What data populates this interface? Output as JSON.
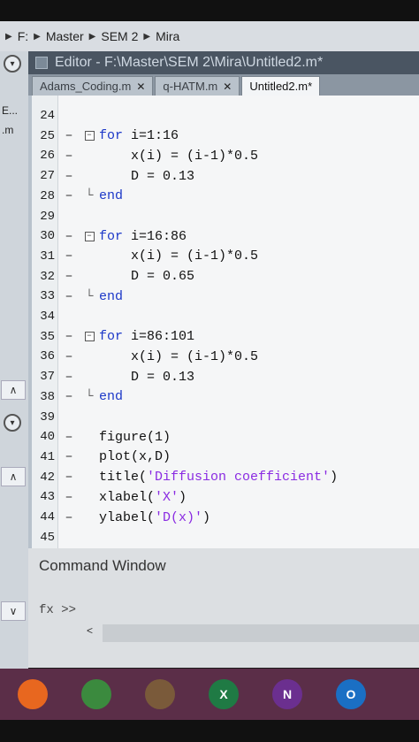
{
  "breadcrumb": {
    "items": [
      "F:",
      "Master",
      "SEM 2",
      "Mira"
    ]
  },
  "left_panel": {
    "file_labels": [
      "E...",
      ".m"
    ]
  },
  "editor": {
    "title": "Editor - F:\\Master\\SEM 2\\Mira\\Untitled2.m*",
    "tabs": [
      {
        "label": "Adams_Coding.m",
        "active": false,
        "closable": true
      },
      {
        "label": "q-HATM.m",
        "active": false,
        "closable": true
      },
      {
        "label": "Untitled2.m*",
        "active": true,
        "closable": false
      }
    ]
  },
  "code_lines": [
    {
      "num": "24",
      "dash": "",
      "fold": "",
      "text": ""
    },
    {
      "num": "25",
      "dash": "–",
      "fold": "⊟",
      "kw": "for",
      "text": " i=1:16"
    },
    {
      "num": "26",
      "dash": "–",
      "fold": "",
      "text": "    x(i) = (i-1)*0.5"
    },
    {
      "num": "27",
      "dash": "–",
      "fold": "",
      "text": "    D = 0.13"
    },
    {
      "num": "28",
      "dash": "–",
      "fold": "└",
      "kw": "end",
      "text": ""
    },
    {
      "num": "29",
      "dash": "",
      "fold": "",
      "text": ""
    },
    {
      "num": "30",
      "dash": "–",
      "fold": "⊟",
      "kw": "for",
      "text": " i=16:86"
    },
    {
      "num": "31",
      "dash": "–",
      "fold": "",
      "text": "    x(i) = (i-1)*0.5"
    },
    {
      "num": "32",
      "dash": "–",
      "fold": "",
      "text": "    D = 0.65"
    },
    {
      "num": "33",
      "dash": "–",
      "fold": "└",
      "kw": "end",
      "text": ""
    },
    {
      "num": "34",
      "dash": "",
      "fold": "",
      "text": ""
    },
    {
      "num": "35",
      "dash": "–",
      "fold": "⊟",
      "kw": "for",
      "text": " i=86:101"
    },
    {
      "num": "36",
      "dash": "–",
      "fold": "",
      "text": "    x(i) = (i-1)*0.5"
    },
    {
      "num": "37",
      "dash": "–",
      "fold": "",
      "text": "    D = 0.13"
    },
    {
      "num": "38",
      "dash": "–",
      "fold": "└",
      "kw": "end",
      "text": ""
    },
    {
      "num": "39",
      "dash": "",
      "fold": "",
      "text": ""
    },
    {
      "num": "40",
      "dash": "–",
      "fold": "",
      "text": "figure(1)"
    },
    {
      "num": "41",
      "dash": "–",
      "fold": "",
      "text": "plot(x,D)"
    },
    {
      "num": "42",
      "dash": "–",
      "fold": "",
      "text": "title(",
      "str": "'Diffusion coefficient'",
      "tail": ")"
    },
    {
      "num": "43",
      "dash": "–",
      "fold": "",
      "text": "xlabel(",
      "str": "'X'",
      "tail": ")"
    },
    {
      "num": "44",
      "dash": "–",
      "fold": "",
      "text": "ylabel(",
      "str": "'D(x)'",
      "tail": ")"
    },
    {
      "num": "45",
      "dash": "",
      "fold": "",
      "text": ""
    }
  ],
  "command_window": {
    "title": "Command Window",
    "prompt": "fx >>",
    "scroll_arrow": "<"
  },
  "taskbar": {
    "apps": [
      {
        "icon": "firefox-icon",
        "color": "#e8671f",
        "glyph": ""
      },
      {
        "icon": "chrome-icon",
        "color": "#3b8a3e",
        "glyph": ""
      },
      {
        "icon": "minecraft-icon",
        "color": "#7a5a3a",
        "glyph": ""
      },
      {
        "icon": "excel-icon",
        "color": "#1f7a44",
        "glyph": "X"
      },
      {
        "icon": "onenote-icon",
        "color": "#6b2f8f",
        "glyph": "N"
      },
      {
        "icon": "outlook-icon",
        "color": "#1a6fc4",
        "glyph": "O"
      }
    ]
  }
}
